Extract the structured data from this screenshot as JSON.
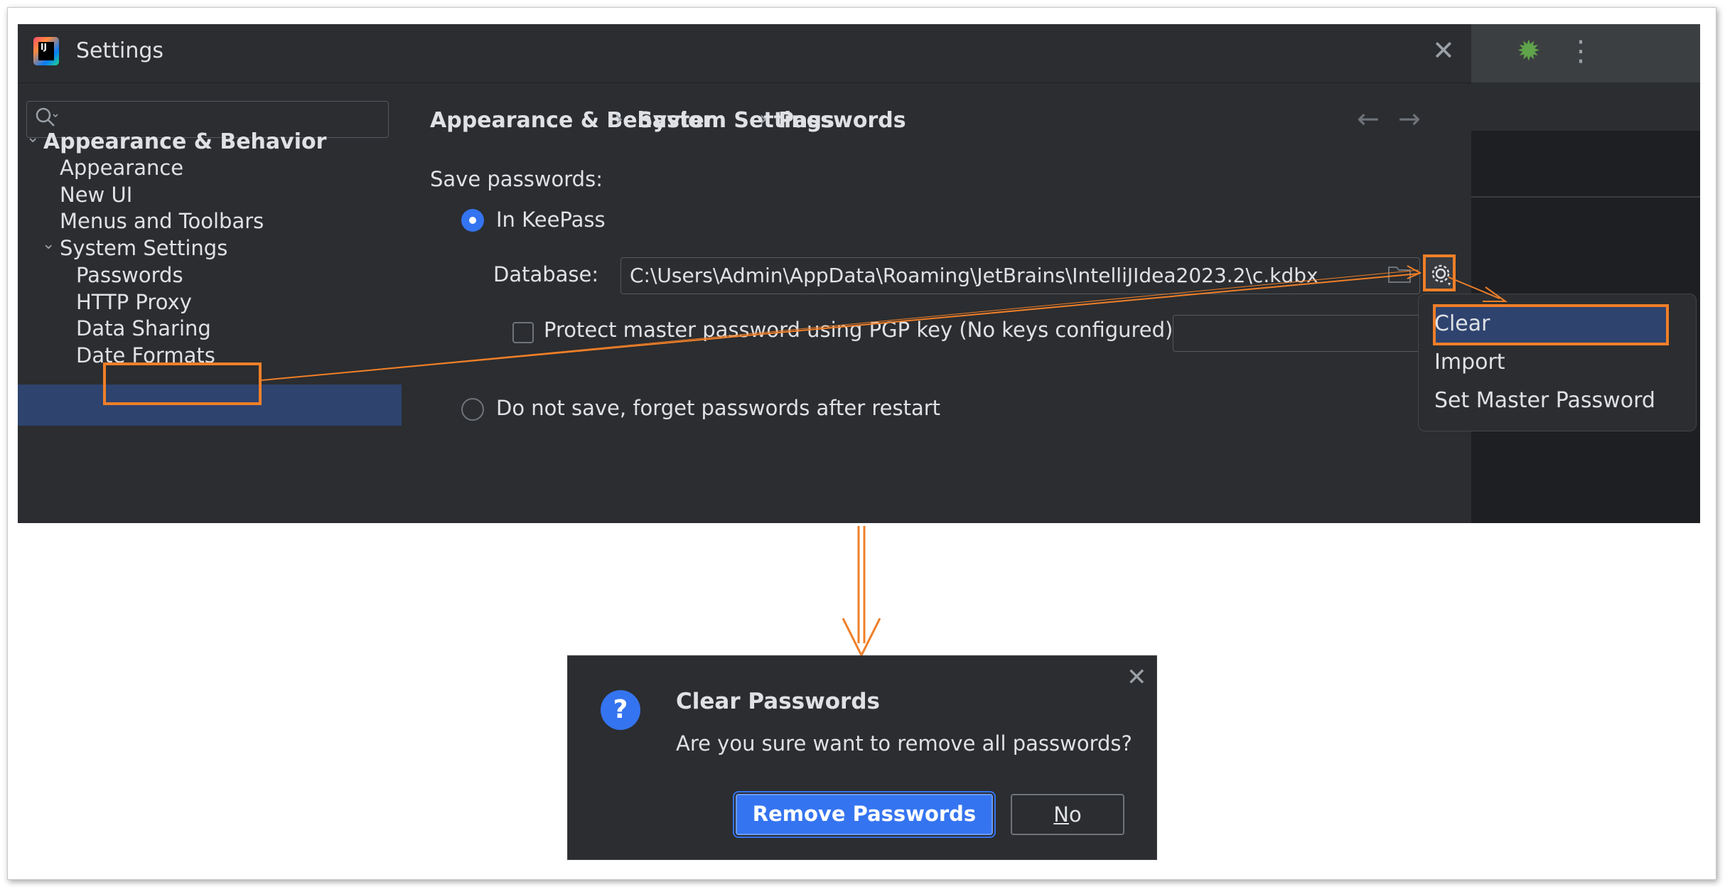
{
  "window": {
    "title": "Settings",
    "close_glyph": "✕"
  },
  "ide_toolbar": {
    "bug_icon": "bug-icon",
    "more_glyph": "⋮",
    "bug_glyph": "🐞"
  },
  "search": {
    "placeholder": "",
    "icon_glyph": "⌕"
  },
  "sidebar": {
    "group": "Appearance & Behavior",
    "items": [
      {
        "label": "Appearance"
      },
      {
        "label": "New UI"
      },
      {
        "label": "Menus and Toolbars"
      }
    ],
    "subgroup": "System Settings",
    "subitems": [
      {
        "label": "Passwords",
        "selected": true
      },
      {
        "label": "HTTP Proxy"
      },
      {
        "label": "Data Sharing"
      },
      {
        "label": "Date Formats"
      }
    ]
  },
  "breadcrumb": [
    "Appearance & Behavior",
    "System Settings",
    "Passwords"
  ],
  "breadcrumb_sep": "›",
  "nav": {
    "back": "←",
    "forward": "→"
  },
  "passwords": {
    "save_label": "Save passwords:",
    "option_keepass": "In KeePass",
    "database_label": "Database:",
    "database_value": "C:\\Users\\Admin\\AppData\\Roaming\\JetBrains\\IntelliJIdea2023.2\\c.kdbx",
    "pgp_label": "Protect master password using PGP key (No keys configured)",
    "option_no_save": "Do not save, forget passwords after restart"
  },
  "popup_menu": {
    "items": [
      "Clear",
      "Import",
      "Set Master Password"
    ]
  },
  "dialog": {
    "icon_glyph": "?",
    "title": "Clear Passwords",
    "message": "Are you sure want to remove all passwords?",
    "primary_button": "Remove Passwords",
    "secondary_mnemonic": "N",
    "secondary_rest": "o",
    "close_glyph": "✕"
  },
  "colors": {
    "accent": "#3574f0",
    "annotation": "#f07f28",
    "panel": "#2b2d30",
    "selection": "#2e436e"
  }
}
